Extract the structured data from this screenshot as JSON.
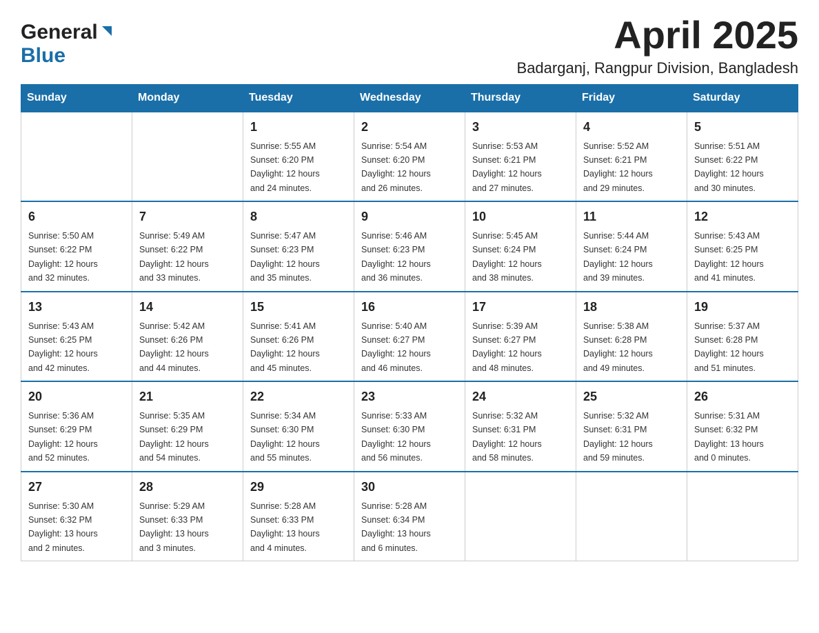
{
  "header": {
    "logo_general": "General",
    "logo_blue": "Blue",
    "title": "April 2025",
    "subtitle": "Badarganj, Rangpur Division, Bangladesh"
  },
  "calendar": {
    "days_of_week": [
      "Sunday",
      "Monday",
      "Tuesday",
      "Wednesday",
      "Thursday",
      "Friday",
      "Saturday"
    ],
    "weeks": [
      [
        {
          "day": "",
          "info": ""
        },
        {
          "day": "",
          "info": ""
        },
        {
          "day": "1",
          "info": "Sunrise: 5:55 AM\nSunset: 6:20 PM\nDaylight: 12 hours\nand 24 minutes."
        },
        {
          "day": "2",
          "info": "Sunrise: 5:54 AM\nSunset: 6:20 PM\nDaylight: 12 hours\nand 26 minutes."
        },
        {
          "day": "3",
          "info": "Sunrise: 5:53 AM\nSunset: 6:21 PM\nDaylight: 12 hours\nand 27 minutes."
        },
        {
          "day": "4",
          "info": "Sunrise: 5:52 AM\nSunset: 6:21 PM\nDaylight: 12 hours\nand 29 minutes."
        },
        {
          "day": "5",
          "info": "Sunrise: 5:51 AM\nSunset: 6:22 PM\nDaylight: 12 hours\nand 30 minutes."
        }
      ],
      [
        {
          "day": "6",
          "info": "Sunrise: 5:50 AM\nSunset: 6:22 PM\nDaylight: 12 hours\nand 32 minutes."
        },
        {
          "day": "7",
          "info": "Sunrise: 5:49 AM\nSunset: 6:22 PM\nDaylight: 12 hours\nand 33 minutes."
        },
        {
          "day": "8",
          "info": "Sunrise: 5:47 AM\nSunset: 6:23 PM\nDaylight: 12 hours\nand 35 minutes."
        },
        {
          "day": "9",
          "info": "Sunrise: 5:46 AM\nSunset: 6:23 PM\nDaylight: 12 hours\nand 36 minutes."
        },
        {
          "day": "10",
          "info": "Sunrise: 5:45 AM\nSunset: 6:24 PM\nDaylight: 12 hours\nand 38 minutes."
        },
        {
          "day": "11",
          "info": "Sunrise: 5:44 AM\nSunset: 6:24 PM\nDaylight: 12 hours\nand 39 minutes."
        },
        {
          "day": "12",
          "info": "Sunrise: 5:43 AM\nSunset: 6:25 PM\nDaylight: 12 hours\nand 41 minutes."
        }
      ],
      [
        {
          "day": "13",
          "info": "Sunrise: 5:43 AM\nSunset: 6:25 PM\nDaylight: 12 hours\nand 42 minutes."
        },
        {
          "day": "14",
          "info": "Sunrise: 5:42 AM\nSunset: 6:26 PM\nDaylight: 12 hours\nand 44 minutes."
        },
        {
          "day": "15",
          "info": "Sunrise: 5:41 AM\nSunset: 6:26 PM\nDaylight: 12 hours\nand 45 minutes."
        },
        {
          "day": "16",
          "info": "Sunrise: 5:40 AM\nSunset: 6:27 PM\nDaylight: 12 hours\nand 46 minutes."
        },
        {
          "day": "17",
          "info": "Sunrise: 5:39 AM\nSunset: 6:27 PM\nDaylight: 12 hours\nand 48 minutes."
        },
        {
          "day": "18",
          "info": "Sunrise: 5:38 AM\nSunset: 6:28 PM\nDaylight: 12 hours\nand 49 minutes."
        },
        {
          "day": "19",
          "info": "Sunrise: 5:37 AM\nSunset: 6:28 PM\nDaylight: 12 hours\nand 51 minutes."
        }
      ],
      [
        {
          "day": "20",
          "info": "Sunrise: 5:36 AM\nSunset: 6:29 PM\nDaylight: 12 hours\nand 52 minutes."
        },
        {
          "day": "21",
          "info": "Sunrise: 5:35 AM\nSunset: 6:29 PM\nDaylight: 12 hours\nand 54 minutes."
        },
        {
          "day": "22",
          "info": "Sunrise: 5:34 AM\nSunset: 6:30 PM\nDaylight: 12 hours\nand 55 minutes."
        },
        {
          "day": "23",
          "info": "Sunrise: 5:33 AM\nSunset: 6:30 PM\nDaylight: 12 hours\nand 56 minutes."
        },
        {
          "day": "24",
          "info": "Sunrise: 5:32 AM\nSunset: 6:31 PM\nDaylight: 12 hours\nand 58 minutes."
        },
        {
          "day": "25",
          "info": "Sunrise: 5:32 AM\nSunset: 6:31 PM\nDaylight: 12 hours\nand 59 minutes."
        },
        {
          "day": "26",
          "info": "Sunrise: 5:31 AM\nSunset: 6:32 PM\nDaylight: 13 hours\nand 0 minutes."
        }
      ],
      [
        {
          "day": "27",
          "info": "Sunrise: 5:30 AM\nSunset: 6:32 PM\nDaylight: 13 hours\nand 2 minutes."
        },
        {
          "day": "28",
          "info": "Sunrise: 5:29 AM\nSunset: 6:33 PM\nDaylight: 13 hours\nand 3 minutes."
        },
        {
          "day": "29",
          "info": "Sunrise: 5:28 AM\nSunset: 6:33 PM\nDaylight: 13 hours\nand 4 minutes."
        },
        {
          "day": "30",
          "info": "Sunrise: 5:28 AM\nSunset: 6:34 PM\nDaylight: 13 hours\nand 6 minutes."
        },
        {
          "day": "",
          "info": ""
        },
        {
          "day": "",
          "info": ""
        },
        {
          "day": "",
          "info": ""
        }
      ]
    ]
  }
}
